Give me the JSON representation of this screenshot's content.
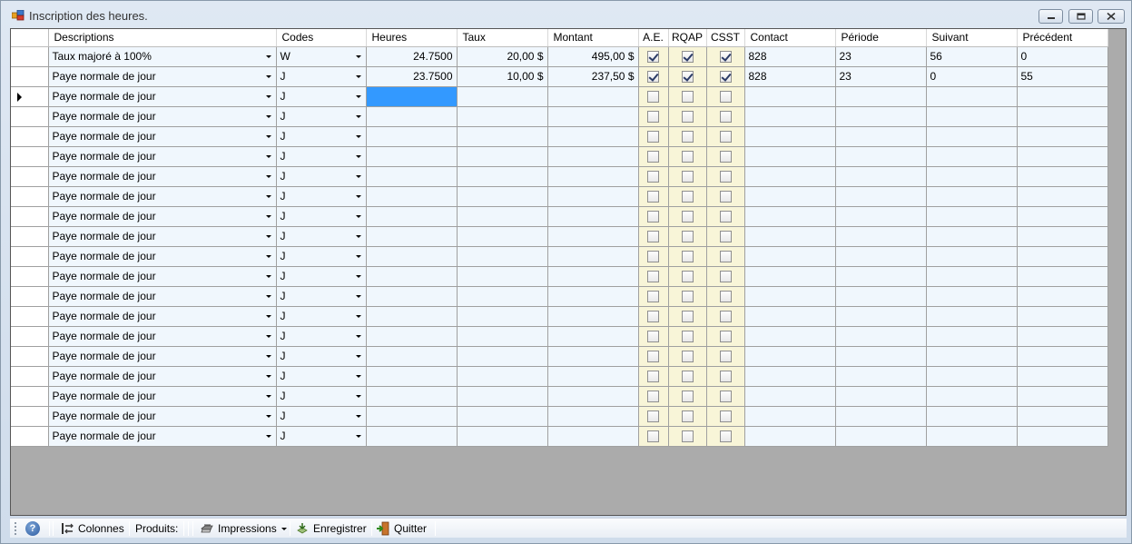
{
  "window": {
    "title": "Inscription des heures."
  },
  "grid": {
    "columns": [
      "Descriptions",
      "Codes",
      "Heures",
      "Taux",
      "Montant",
      "A.E.",
      "RQAP",
      "CSST",
      "Contact",
      "Période",
      "Suivant",
      "Précédent"
    ],
    "rows": [
      {
        "description": "Taux majoré à 100%",
        "code": "W",
        "heures": "24.7500",
        "taux": "20,00 $",
        "montant": "495,00 $",
        "ae": true,
        "rqap": true,
        "csst": true,
        "contact": "828",
        "periode": "23",
        "suivant": "56",
        "precedent": "0"
      },
      {
        "description": "Paye normale de jour",
        "code": "J",
        "heures": "23.7500",
        "taux": "10,00 $",
        "montant": "237,50 $",
        "ae": true,
        "rqap": true,
        "csst": true,
        "contact": "828",
        "periode": "23",
        "suivant": "0",
        "precedent": "55"
      },
      {
        "description": "Paye normale de jour",
        "code": "J",
        "heures": "",
        "taux": "",
        "montant": "",
        "ae": false,
        "rqap": false,
        "csst": false,
        "contact": "",
        "periode": "",
        "suivant": "",
        "precedent": "",
        "current": true
      },
      {
        "description": "Paye normale de jour",
        "code": "J",
        "heures": "",
        "taux": "",
        "montant": "",
        "ae": false,
        "rqap": false,
        "csst": false,
        "contact": "",
        "periode": "",
        "suivant": "",
        "precedent": ""
      },
      {
        "description": "Paye normale de jour",
        "code": "J",
        "heures": "",
        "taux": "",
        "montant": "",
        "ae": false,
        "rqap": false,
        "csst": false,
        "contact": "",
        "periode": "",
        "suivant": "",
        "precedent": ""
      },
      {
        "description": "Paye normale de jour",
        "code": "J",
        "heures": "",
        "taux": "",
        "montant": "",
        "ae": false,
        "rqap": false,
        "csst": false,
        "contact": "",
        "periode": "",
        "suivant": "",
        "precedent": ""
      },
      {
        "description": "Paye normale de jour",
        "code": "J",
        "heures": "",
        "taux": "",
        "montant": "",
        "ae": false,
        "rqap": false,
        "csst": false,
        "contact": "",
        "periode": "",
        "suivant": "",
        "precedent": ""
      },
      {
        "description": "Paye normale de jour",
        "code": "J",
        "heures": "",
        "taux": "",
        "montant": "",
        "ae": false,
        "rqap": false,
        "csst": false,
        "contact": "",
        "periode": "",
        "suivant": "",
        "precedent": ""
      },
      {
        "description": "Paye normale de jour",
        "code": "J",
        "heures": "",
        "taux": "",
        "montant": "",
        "ae": false,
        "rqap": false,
        "csst": false,
        "contact": "",
        "periode": "",
        "suivant": "",
        "precedent": ""
      },
      {
        "description": "Paye normale de jour",
        "code": "J",
        "heures": "",
        "taux": "",
        "montant": "",
        "ae": false,
        "rqap": false,
        "csst": false,
        "contact": "",
        "periode": "",
        "suivant": "",
        "precedent": ""
      },
      {
        "description": "Paye normale de jour",
        "code": "J",
        "heures": "",
        "taux": "",
        "montant": "",
        "ae": false,
        "rqap": false,
        "csst": false,
        "contact": "",
        "periode": "",
        "suivant": "",
        "precedent": ""
      },
      {
        "description": "Paye normale de jour",
        "code": "J",
        "heures": "",
        "taux": "",
        "montant": "",
        "ae": false,
        "rqap": false,
        "csst": false,
        "contact": "",
        "periode": "",
        "suivant": "",
        "precedent": ""
      },
      {
        "description": "Paye normale de jour",
        "code": "J",
        "heures": "",
        "taux": "",
        "montant": "",
        "ae": false,
        "rqap": false,
        "csst": false,
        "contact": "",
        "periode": "",
        "suivant": "",
        "precedent": ""
      },
      {
        "description": "Paye normale de jour",
        "code": "J",
        "heures": "",
        "taux": "",
        "montant": "",
        "ae": false,
        "rqap": false,
        "csst": false,
        "contact": "",
        "periode": "",
        "suivant": "",
        "precedent": ""
      },
      {
        "description": "Paye normale de jour",
        "code": "J",
        "heures": "",
        "taux": "",
        "montant": "",
        "ae": false,
        "rqap": false,
        "csst": false,
        "contact": "",
        "periode": "",
        "suivant": "",
        "precedent": ""
      },
      {
        "description": "Paye normale de jour",
        "code": "J",
        "heures": "",
        "taux": "",
        "montant": "",
        "ae": false,
        "rqap": false,
        "csst": false,
        "contact": "",
        "periode": "",
        "suivant": "",
        "precedent": ""
      },
      {
        "description": "Paye normale de jour",
        "code": "J",
        "heures": "",
        "taux": "",
        "montant": "",
        "ae": false,
        "rqap": false,
        "csst": false,
        "contact": "",
        "periode": "",
        "suivant": "",
        "precedent": ""
      },
      {
        "description": "Paye normale de jour",
        "code": "J",
        "heures": "",
        "taux": "",
        "montant": "",
        "ae": false,
        "rqap": false,
        "csst": false,
        "contact": "",
        "periode": "",
        "suivant": "",
        "precedent": ""
      },
      {
        "description": "Paye normale de jour",
        "code": "J",
        "heures": "",
        "taux": "",
        "montant": "",
        "ae": false,
        "rqap": false,
        "csst": false,
        "contact": "",
        "periode": "",
        "suivant": "",
        "precedent": ""
      },
      {
        "description": "Paye normale de jour",
        "code": "J",
        "heures": "",
        "taux": "",
        "montant": "",
        "ae": false,
        "rqap": false,
        "csst": false,
        "contact": "",
        "periode": "",
        "suivant": "",
        "precedent": ""
      }
    ]
  },
  "toolbar": {
    "help_icon": "help-icon",
    "colonnes_label": "Colonnes",
    "produits_label": "Produits:",
    "impressions_label": "Impressions",
    "enregistrer_label": "Enregistrer",
    "quitter_label": "Quitter"
  },
  "colors": {
    "cell_background": "#f0f7fd",
    "checkbox_column_background": "#f8f5d8",
    "selected_cell": "#3399ff",
    "grid_background": "#ababab"
  }
}
